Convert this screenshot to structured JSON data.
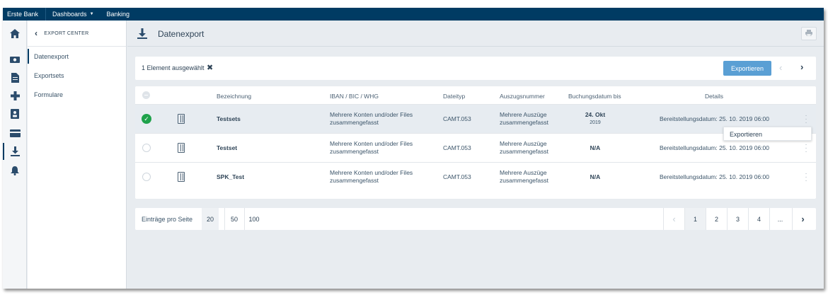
{
  "topbar": {
    "brand": "Erste Bank",
    "dashboards": "Dashboards",
    "banking": "Banking"
  },
  "rail": {
    "icons": [
      "home-icon",
      "money-icon",
      "document-icon",
      "plus-icon",
      "contacts-icon",
      "card-icon",
      "download-icon",
      "bell-icon"
    ],
    "active": "download-icon"
  },
  "subnav": {
    "header": "EXPORT CENTER",
    "items": [
      {
        "label": "Datenexport"
      },
      {
        "label": "Exportsets"
      },
      {
        "label": "Formulare"
      }
    ]
  },
  "page": {
    "title": "Datenexport"
  },
  "selection": {
    "count_text": "1 Element ausgewählt",
    "export_label": "Exportieren"
  },
  "table": {
    "headers": {
      "name": "Bezeichnung",
      "iban": "IBAN / BIC / WHG",
      "type": "Dateityp",
      "auszug": "Auszugsnummer",
      "datum": "Buchungsdatum bis",
      "details": "Details"
    },
    "rows": [
      {
        "selected": true,
        "name": "Testsets",
        "iban_1": "Mehrere Konten und/oder Files",
        "iban_2": "zusammengefasst",
        "type": "CAMT.053",
        "auszug_1": "Mehrere Auszüge",
        "auszug_2": "zusammengefasst",
        "datum": "24. Okt",
        "datum_year": "2019",
        "details": "Bereitstellungsdatum: 25. 10. 2019 06:00"
      },
      {
        "selected": false,
        "name": "Testset",
        "iban_1": "Mehrere Konten und/oder Files",
        "iban_2": "zusammengefasst",
        "type": "CAMT.053",
        "auszug_1": "Mehrere Auszüge",
        "auszug_2": "zusammengefasst",
        "datum": "N/A",
        "datum_year": "",
        "details": "Bereitstellungsdatum: 25. 10. 2019 06:00"
      },
      {
        "selected": false,
        "name": "SPK_Test",
        "iban_1": "Mehrere Konten und/oder Files",
        "iban_2": "zusammengefasst",
        "type": "CAMT.053",
        "auszug_1": "Mehrere Auszüge",
        "auszug_2": "zusammengefasst",
        "datum": "N/A",
        "datum_year": "",
        "details": "Bereitstellungsdatum: 25. 10. 2019 06:00"
      }
    ]
  },
  "row_menu": {
    "item": "Exportieren"
  },
  "pagination": {
    "label": "Einträge pro Seite",
    "sizes": [
      "20",
      "50",
      "100"
    ],
    "active_size": "20",
    "pages": [
      "1",
      "2",
      "3",
      "4",
      "..."
    ],
    "active_page": "1"
  },
  "colors": {
    "topbar": "#003b63",
    "accent": "#5a9fd4",
    "success": "#1fa24b"
  }
}
